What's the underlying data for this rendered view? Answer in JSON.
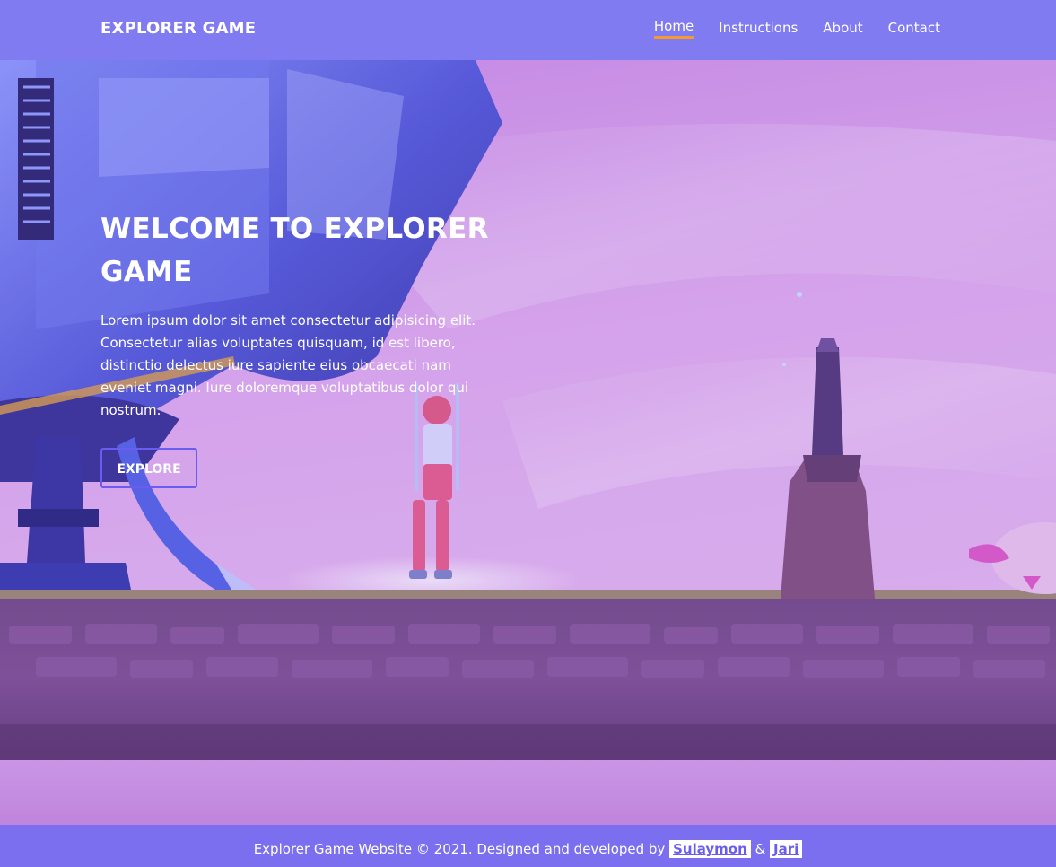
{
  "navbar": {
    "brand": "EXPLORER GAME",
    "links": [
      {
        "label": "Home",
        "active": true
      },
      {
        "label": "Instructions",
        "active": false
      },
      {
        "label": "About",
        "active": false
      },
      {
        "label": "Contact",
        "active": false
      }
    ]
  },
  "hero": {
    "title_line1": "WELCOME TO EXPLORER",
    "title_line2": "GAME",
    "text": "Lorem ipsum dolor sit amet consectetur adipisicing elit. Consectetur alias voluptates quisquam, id est libero, distinctio delectus iure sapiente eius obcaecati nam eveniet magni. Iure doloremque voluptatibus dolor qui nostrum.",
    "button_label": "EXPLORE"
  },
  "footer": {
    "text": "Explorer Game Website © 2021. Designed and developed by",
    "author1": "Sulaymon",
    "separator": "&",
    "author2": "Jari"
  },
  "colors": {
    "navbar": "#817bf2",
    "footer": "#7b6ff0",
    "accent_underline": "#f39a32",
    "button_border": "#6a5cf0"
  }
}
